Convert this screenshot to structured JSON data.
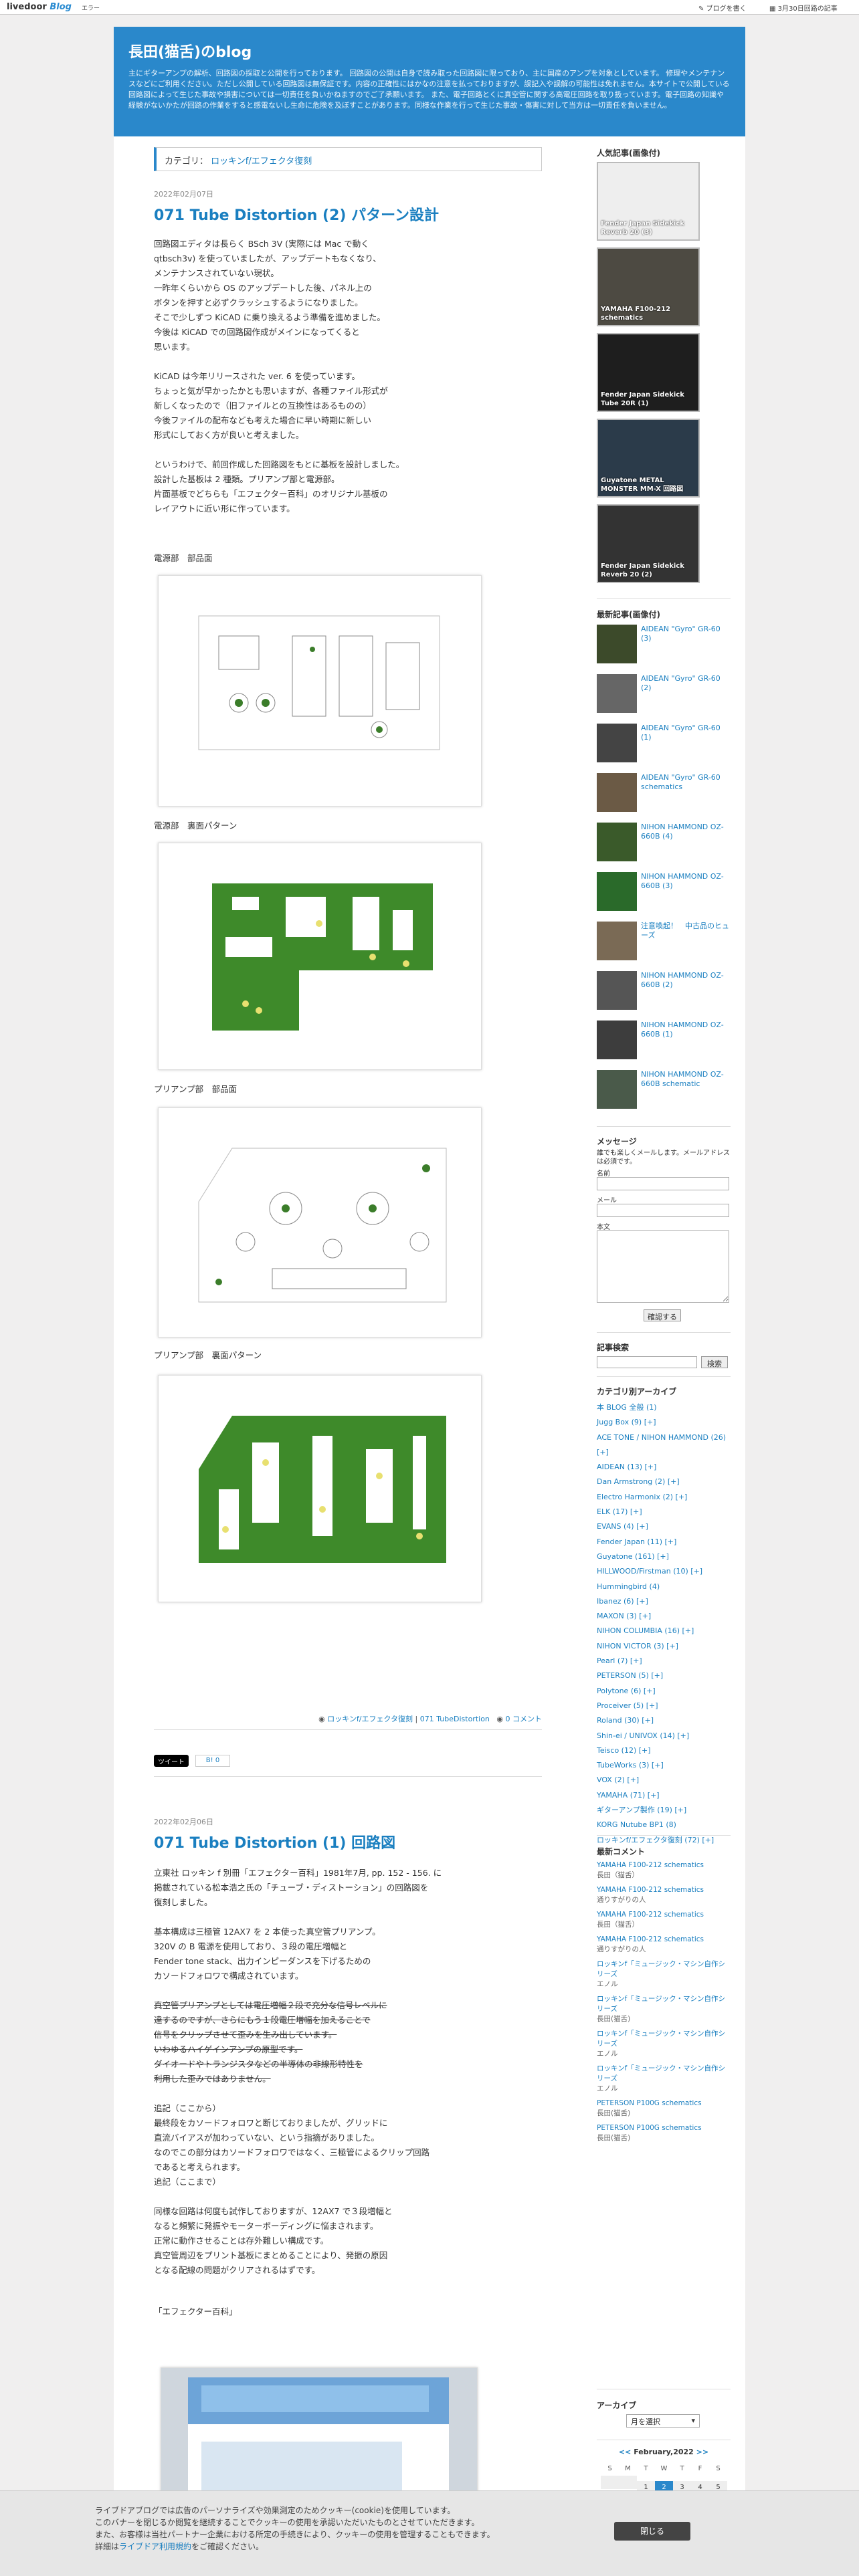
{
  "topbar": {
    "logo_main": "livedoor",
    "logo_blog": "Blog",
    "error_label": "エラー",
    "write_link": "ブログを書く",
    "date_link": "3月30日回路の記事"
  },
  "blog": {
    "title": "長田(猫舌)のblog",
    "description": "主にギターアンプの解析、回路図の採取と公開を行っております。 回路図の公開は自身で読み取った回路図に限っており、主に国産のアンプを対象としています。 修理やメンテナンスなどにご利用ください。ただし公開している回路図は無保証です。内容の正確性にはかなの注意を払っておりますが、誤記入や誤解の可能性は免れません。本サイトで公開している回路図によって生じた事故や損害については一切責任を負いかねますのでご了承願います。 また、電子回路とくに真空管に関する高電圧回路を取り扱っています。電子回路の知識や経験がないかたが回路の作業をすると感電ないし生命に危険を及ぼすことがあります。同様な作業を行って生じた事故・傷害に対して当方は一切責任を負いません。"
  },
  "category_bar": {
    "label": "カテゴリ：",
    "value": "ロッキンf/エフェクタ復刻"
  },
  "post1": {
    "date": "2022年02月07日",
    "title": "071 Tube Distortion (2) パターン設計",
    "body": "回路図エディタは長らく BSch 3V (実際には Mac で動く\nqtbsch3v) を使っていましたが、アップデートもなくなり、\nメンテナンスされていない現状。\n一昨年くらいから OS のアップデートした後、パネル上の\nボタンを押すと必ずクラッシュするようになりました。\nそこで少しずつ KiCAD に乗り換えるよう準備を進めました。\n今後は KiCAD での回路図作成がメインになってくると\n思います。\n\nKiCAD は今年リリースされた ver. 6 を使っています。\nちょっと気が早かったかとも思いますが、各種ファイル形式が\n新しくなったので（旧ファイルとの互換性はあるものの）\n今後ファイルの配布なども考えた場合に早い時期に新しい\n形式にしておく方が良いと考えました。\n\nというわけで、前回作成した回路図をもとに基板を設計しました。\n設計した基板は 2 種類。プリアンプ部と電源部。\n片面基板でどちらも「エフェクター百科」のオリジナル基板の\nレイアウトに近い形に作っています。",
    "captions": [
      "電源部　部品面",
      "電源部　裏面パターン",
      "プリアンプ部　部品面",
      "プリアンプ部　裏面パターン"
    ],
    "category": "ロッキンf/エフェクタ復刻",
    "tag": "071 TubeDistortion",
    "comments": "0 コメント",
    "tweet": "ツイート",
    "hatena": "B! 0"
  },
  "post2": {
    "date": "2022年02月06日",
    "title": "071 Tube Distortion (1) 回路図",
    "body": "立東社 ロッキン f 別冊「エフェクター百科」1981年7月, pp. 152 - 156. に\n掲載されている松本浩之氏の「チューブ・ディストーション」の回路図を\n復刻しました。\n\n基本構成は三極管 12AX7 を 2 本使った真空管プリアンプ。\n320V の B 電源を使用しており、３段の電圧増幅と\nFender tone stack、出力インピーダンスを下げるための\nカソードフォロワで構成されています。",
    "strike": "真空管プリアンプとしては電圧増幅２段で充分な信号レベルに\n達するのですが、さらにもう１段電圧増幅を加えることで\n信号をクリップさせて歪みを生み出しています。\nいわゆるハイゲインアンプの原型です。\nダイオードやトランジスタなどの半導体の非線形特性を\n利用した歪みではありません。",
    "addendum": "追記（ここから）\n最終段をカソードフォロワと断じておりましたが、グリッドに\n直流バイアスが加わっていない、という指摘がありました。\nなのでこの部分はカソードフォロワではなく、三極管によるクリップ回路\nであると考えられます。\n追記（ここまで）\n\n同様な回路は何度も試作しておりますが、12AX7 で３段増幅と\nなると頻繁に発振やモーターボーディングに悩まされます。\n正常に動作させることは存外難しい構成です。\n真空管周辺をプリント基板にまとめることにより、発振の原因\nとなる配線の問題がクリアされるはずです。",
    "caption": "「エフェクター百科」"
  },
  "sidebar": {
    "popular_title": "人気記事(画像付)",
    "popular": [
      "Fender Japan Sidekick Reverb 20 (3)",
      "YAMAHA F100-212 schematics",
      "Fender Japan Sidekick Tube 20R (1)",
      "Guyatone METAL MONSTER MM-X 回路図",
      "Fender Japan Sidekick Reverb 20 (2)"
    ],
    "recent_title": "最新記事(画像付)",
    "recent": [
      "AIDEAN \"Gyro\" GR-60 (3)",
      "AIDEAN \"Gyro\" GR-60 (2)",
      "AIDEAN \"Gyro\" GR-60 (1)",
      "AIDEAN \"Gyro\" GR-60 schematics",
      "NIHON HAMMOND OZ-660B (4)",
      "NIHON HAMMOND OZ-660B (3)",
      "注意喚起！　中古品のヒューズ",
      "NIHON HAMMOND OZ-660B (2)",
      "NIHON HAMMOND OZ-660B (1)",
      "NIHON HAMMOND OZ-660B schematic"
    ],
    "message_title": "メッセージ",
    "message_note": "誰でも楽しくメールします。メールアドレスは必須です。",
    "name_label": "名前",
    "mail_label": "メール",
    "body_label": "本文",
    "confirm_btn": "確認する",
    "search_title": "記事検索",
    "search_btn": "検索",
    "cat_title": "カテゴリ別アーカイブ",
    "cats": [
      "本 BLOG 全般 (1)",
      "Jugg Box (9) [+]",
      "ACE TONE / NIHON HAMMOND (26) [+]",
      "AIDEAN (13) [+]",
      "Dan Armstrong (2) [+]",
      "Electro Harmonix (2) [+]",
      "ELK (17) [+]",
      "EVANS (4) [+]",
      "Fender Japan (11) [+]",
      "Guyatone (161) [+]",
      "HILLWOOD/Firstman (10) [+]",
      "Hummingbird (4)",
      "Ibanez (6) [+]",
      "MAXON (3) [+]",
      "NIHON COLUMBIA (16) [+]",
      "NIHON VICTOR (3) [+]",
      "Pearl (7) [+]",
      "PETERSON (5) [+]",
      "Polytone (6) [+]",
      "Proceiver (5) [+]",
      "Roland (30) [+]",
      "Shin-ei / UNIVOX (14) [+]",
      "Teisco (12) [+]",
      "TubeWorks (3) [+]",
      "VOX (2) [+]",
      "YAMAHA (71) [+]",
      "ギターアンプ製作 (19) [+]",
      "KORG Nutube BP1 (8)",
      "ロッキンf/エフェクタ復刻 (72) [+]"
    ],
    "comments_title": "最新コメント",
    "comments": [
      [
        "YAMAHA F100-212 schematics",
        "長田（猫舌）"
      ],
      [
        "YAMAHA F100-212 schematics",
        "通りすがりの人"
      ],
      [
        "YAMAHA F100-212 schematics",
        "長田（猫舌）"
      ],
      [
        "YAMAHA F100-212 schematics",
        "通りすがりの人"
      ],
      [
        "ロッキンf「ミュージック・マシン自作シリーズ",
        "エノル"
      ],
      [
        "ロッキンf「ミュージック・マシン自作シリーズ",
        "長田(猫舌)"
      ],
      [
        "ロッキンf「ミュージック・マシン自作シリーズ",
        "エノル"
      ],
      [
        "ロッキンf「ミュージック・マシン自作シリーズ",
        "エノル"
      ],
      [
        "PETERSON P100G schematics",
        "長田(猫舌)"
      ],
      [
        "PETERSON P100G schematics",
        "長田(猫舌)"
      ]
    ],
    "archive_title": "アーカイブ",
    "archive_select": "月を選択",
    "calendar_title": "February,2022",
    "calendar_days": [
      "S",
      "M",
      "T",
      "W",
      "T",
      "F",
      "S"
    ],
    "calendar_row": [
      "",
      "",
      "1",
      "2",
      "3",
      "4",
      "5"
    ]
  },
  "cookie": {
    "line1": "ライブドアブログでは広告のパーソナライズや効果測定のためクッキー(cookie)を使用しています。",
    "line2": "このバナーを閉じるか閲覧を継続することでクッキーの使用を承認いただいたものとさせていただきます。",
    "line3": "また、お客様は当社パートナー企業における所定の手続きにより、クッキーの使用を管理することもできます。",
    "line4_pre": "詳細は",
    "line4_link": "ライブドア利用規約",
    "line4_post": "をご確認ください。",
    "close": "閉じる"
  }
}
